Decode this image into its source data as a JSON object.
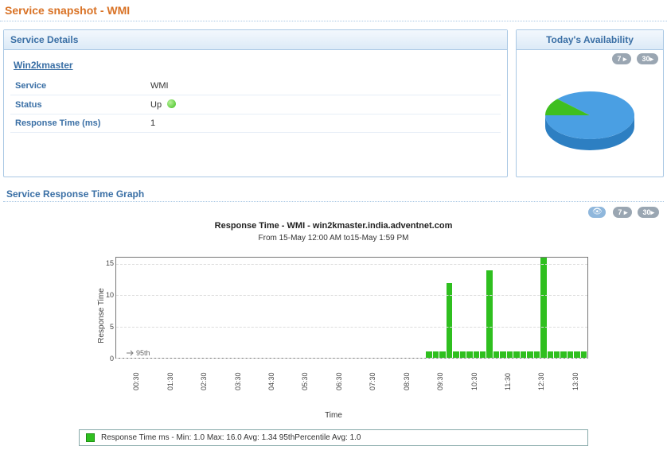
{
  "page_title": "Service snapshot - WMI",
  "service_details": {
    "header": "Service Details",
    "host": "Win2kmaster",
    "rows": {
      "service_k": "Service",
      "service_v": "WMI",
      "status_k": "Status",
      "status_v": "Up",
      "rt_k": "Response Time (ms)",
      "rt_v": "1"
    }
  },
  "availability": {
    "header": "Today's Availability",
    "pills": [
      "7 ▸",
      "30▸"
    ],
    "up_pct": 88,
    "down_pct": 12,
    "colors": {
      "up": "#4a9fe3",
      "down": "#3fbf1f"
    }
  },
  "graph": {
    "section_title": "Service Response Time Graph",
    "pills_icon": "👁",
    "pills": [
      "7 ▸",
      "30▸"
    ],
    "title": "Response Time - WMI  - win2kmaster.india.adventnet.com",
    "subtitle": "From 15-May 12:00 AM to15-May 1:59 PM",
    "ylabel": "Response Time",
    "xlabel": "Time",
    "annotation": "95th",
    "legend": "Response Time ms -    Min: 1.0    Max: 16.0    Avg: 1.34  95thPercentile Avg: 1.0"
  },
  "chart_data": {
    "type": "bar",
    "ylabel": "Response Time",
    "xlabel": "Time",
    "ylim": [
      0,
      16
    ],
    "yticks": [
      0,
      5,
      10,
      15
    ],
    "annotation_95th_y": 1.0,
    "x_tick_labels": [
      "00:30",
      "01:30",
      "02:30",
      "03:30",
      "04:30",
      "05:30",
      "06:30",
      "07:30",
      "08:30",
      "09:30",
      "10:30",
      "11:30",
      "12:30",
      "13:30"
    ],
    "series": [
      {
        "name": "Response Time ms",
        "stats": {
          "min": 1.0,
          "max": 16.0,
          "avg": 1.34,
          "p95_avg": 1.0
        },
        "values": [
          0,
          0,
          0,
          0,
          0,
          0,
          0,
          0,
          0,
          0,
          0,
          0,
          0,
          0,
          0,
          0,
          0,
          0,
          0,
          0,
          0,
          0,
          0,
          0,
          0,
          0,
          0,
          0,
          0,
          0,
          0,
          0,
          0,
          0,
          0,
          0,
          0,
          0,
          0,
          0,
          0,
          0,
          0,
          0,
          0,
          0,
          1,
          1,
          1,
          12,
          1,
          1,
          1,
          1,
          1,
          14,
          1,
          1,
          1,
          1,
          1,
          1,
          1,
          16,
          1,
          1,
          1,
          1,
          1,
          1
        ]
      }
    ]
  }
}
